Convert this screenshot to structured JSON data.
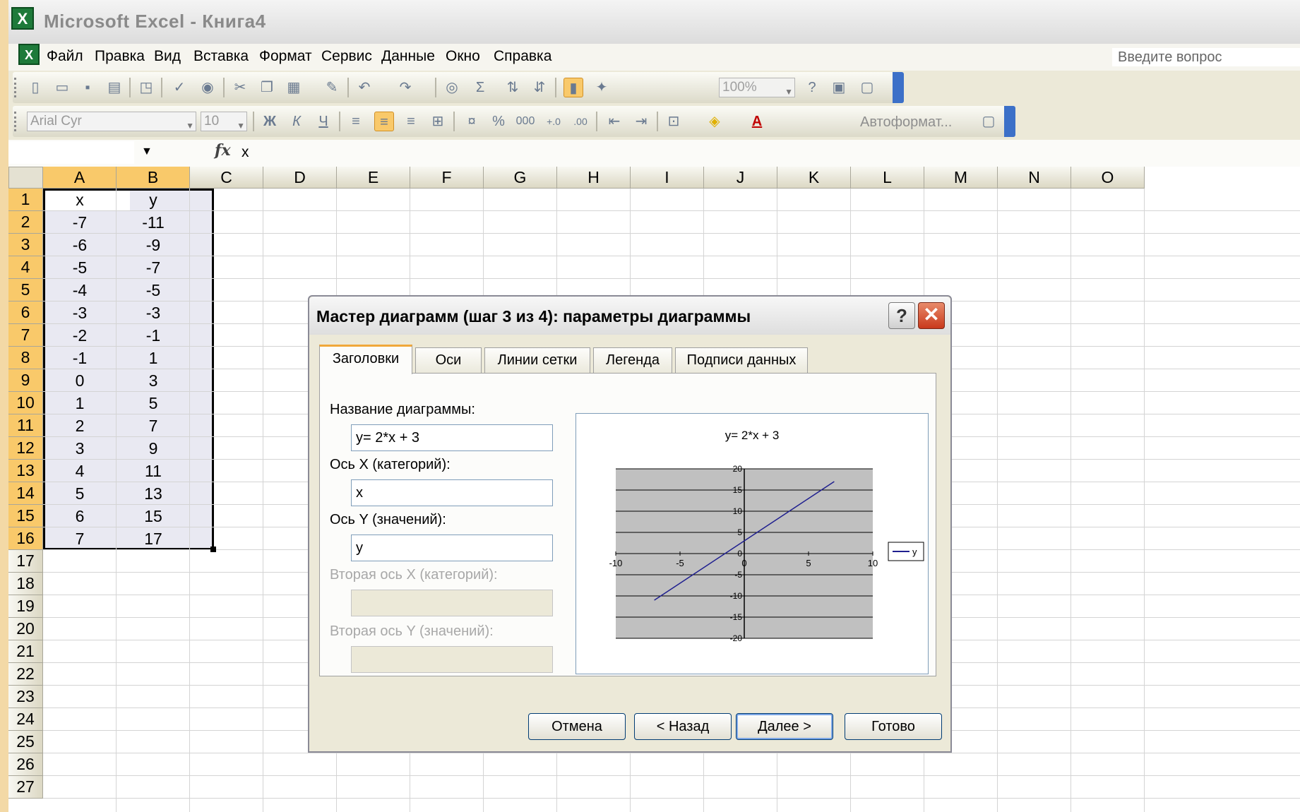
{
  "window": {
    "title": "Microsoft Excel - Книга4",
    "app_icon_glyph": "X"
  },
  "menu": {
    "items": [
      "Файл",
      "Правка",
      "Вид",
      "Вставка",
      "Формат",
      "Сервис",
      "Данные",
      "Окно",
      "Справка"
    ],
    "help_placeholder": "Введите вопрос"
  },
  "toolbar": {
    "zoom": "100%",
    "font_name": "Arial Cyr",
    "font_size": "10",
    "autoformat_label": "Автоформат..."
  },
  "formula_bar": {
    "name_box": "",
    "fx_label": "fx",
    "content": "x"
  },
  "sheet": {
    "columns": [
      "A",
      "B",
      "C",
      "D",
      "E",
      "F",
      "G",
      "H",
      "I",
      "J",
      "K",
      "L",
      "M",
      "N",
      "O"
    ],
    "rows": [
      "1",
      "2",
      "3",
      "4",
      "5",
      "6",
      "7",
      "8",
      "9",
      "10",
      "11",
      "12",
      "13",
      "14",
      "15",
      "16",
      "17",
      "18",
      "19",
      "20",
      "21",
      "22",
      "23",
      "24",
      "25",
      "26",
      "27"
    ],
    "data": [
      [
        "x",
        "y"
      ],
      [
        "-7",
        "-11"
      ],
      [
        "-6",
        "-9"
      ],
      [
        "-5",
        "-7"
      ],
      [
        "-4",
        "-5"
      ],
      [
        "-3",
        "-3"
      ],
      [
        "-2",
        "-1"
      ],
      [
        "-1",
        "1"
      ],
      [
        "0",
        "3"
      ],
      [
        "1",
        "5"
      ],
      [
        "2",
        "7"
      ],
      [
        "3",
        "9"
      ],
      [
        "4",
        "11"
      ],
      [
        "5",
        "13"
      ],
      [
        "6",
        "15"
      ],
      [
        "7",
        "17"
      ]
    ]
  },
  "dialog": {
    "title": "Мастер диаграмм (шаг 3 из 4): параметры диаграммы",
    "help_glyph": "?",
    "close_glyph": "✕",
    "tabs": [
      "Заголовки",
      "Оси",
      "Линии сетки",
      "Легенда",
      "Подписи данных"
    ],
    "active_tab": 0,
    "fields": {
      "chart_title_label": "Название диаграммы:",
      "chart_title_value": "y= 2*x + 3",
      "x_axis_label": "Ось X (категорий):",
      "x_axis_value": "x",
      "y_axis_label": "Ось Y (значений):",
      "y_axis_value": "y",
      "x2_axis_label": "Вторая ось X (категорий):",
      "y2_axis_label": "Вторая ось Y (значений):"
    },
    "buttons": {
      "cancel": "Отмена",
      "back": "< Назад",
      "next": "Далее >",
      "finish": "Готово"
    }
  },
  "chart_data": {
    "type": "line",
    "title": "y= 2*x + 3",
    "x": [
      -7,
      -6,
      -5,
      -4,
      -3,
      -2,
      -1,
      0,
      1,
      2,
      3,
      4,
      5,
      6,
      7
    ],
    "series": [
      {
        "name": "y",
        "values": [
          -11,
          -9,
          -7,
          -5,
          -3,
          -1,
          1,
          3,
          5,
          7,
          9,
          11,
          13,
          15,
          17
        ]
      }
    ],
    "xlim": [
      -10,
      10
    ],
    "ylim": [
      -20,
      20
    ],
    "x_ticks": [
      -10,
      -5,
      0,
      5,
      10
    ],
    "y_ticks": [
      -20,
      -15,
      -10,
      -5,
      0,
      5,
      10,
      15,
      20
    ],
    "grid": true,
    "legend": "right",
    "colors": {
      "line": "#1f1f8f",
      "plot_bg": "#c0c0c0"
    }
  },
  "colors": {
    "selection": "#f9c96a",
    "title_gray": "#8a8a8a"
  }
}
